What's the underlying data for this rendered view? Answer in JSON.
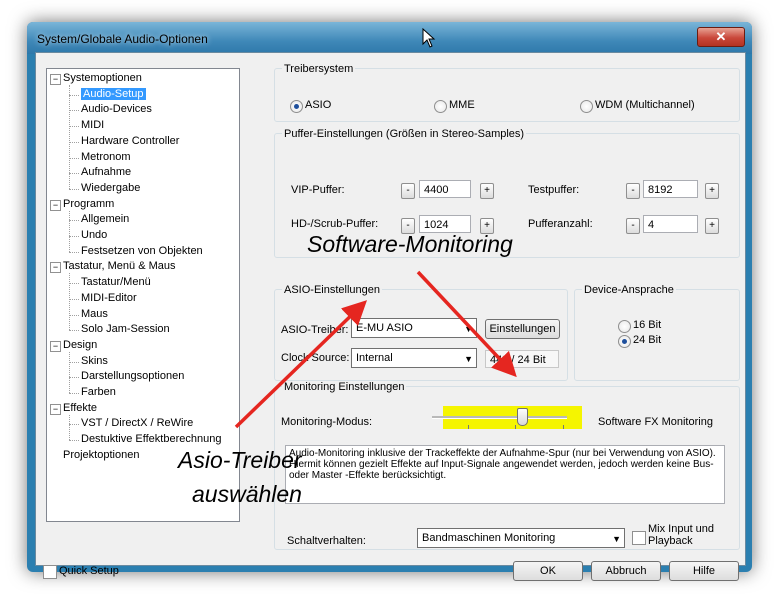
{
  "window": {
    "title": "System/Globale Audio-Optionen",
    "close_glyph": "✕"
  },
  "tree": {
    "items": [
      "Systemoptionen",
      "Audio-Setup",
      "Audio-Devices",
      "MIDI",
      "Hardware Controller",
      "Metronom",
      "Aufnahme",
      "Wiedergabe",
      "Programm",
      "Allgemein",
      "Undo",
      "Festsetzen von Objekten",
      "Tastatur, Menü & Maus",
      "Tastatur/Menü",
      "MIDI-Editor",
      "Maus",
      "Solo Jam-Session",
      "Design",
      "Skins",
      "Darstellungsoptionen",
      "Farben",
      "Effekte",
      "VST / DirectX / ReWire",
      "Destuktive Effektberechnung",
      "Projektoptionen"
    ],
    "expander": "−",
    "selected": "Audio-Setup"
  },
  "treiber": {
    "title": "Treibersystem",
    "options": [
      "ASIO",
      "MME",
      "WDM (Multichannel)"
    ],
    "selected": "ASIO"
  },
  "puffer": {
    "title": "Puffer-Einstellungen (Größen in Stereo-Samples)",
    "vip_label": "VIP-Puffer:",
    "vip_value": "4400",
    "hd_label": "HD-/Scrub-Puffer:",
    "hd_value": "1024",
    "test_label": "Testpuffer:",
    "test_value": "8192",
    "anzahl_label": "Pufferanzahl:",
    "anzahl_value": "4",
    "minus": "-",
    "plus": "+"
  },
  "asio": {
    "title": "ASIO-Einstellungen",
    "driver_label": "ASIO-Treiber:",
    "driver_value": "E-MU ASIO",
    "settings_button": "Einstellungen",
    "clock_label": "Clock Source:",
    "clock_value": "Internal",
    "format": "440 / 24 Bit",
    "arrow": "▼"
  },
  "device": {
    "title": "Device-Ansprache",
    "options": [
      "16 Bit",
      "24 Bit"
    ],
    "selected": "24 Bit"
  },
  "monitoring": {
    "title": "Monitoring Einstellungen",
    "mode_label": "Monitoring-Modus:",
    "mode_value": "Software FX Monitoring",
    "slider_fraction": 0.67,
    "highlight_color": "#f5f500",
    "description": "Audio-Monitoring inklusive der Trackeffekte der Aufnahme-Spur (nur bei Verwendung von ASIO). Hiermit können gezielt Effekte auf Input-Signale angewendet werden, jedoch werden keine Bus- oder Master -Effekte berücksichtigt.",
    "switch_label": "Schaltverhalten:",
    "switch_value": "Bandmaschinen Monitoring",
    "mix_label_1": "Mix Input und",
    "mix_label_2": "Playback"
  },
  "bottom": {
    "quick_setup": "Quick Setup",
    "ok": "OK",
    "cancel": "Abbruch",
    "help": "Hilfe"
  },
  "annotations": {
    "software_monitoring": "Software-Monitoring",
    "asio_line1": "Asio-Treiber",
    "asio_line2": "auswählen",
    "arrow_color": "#e52620"
  }
}
